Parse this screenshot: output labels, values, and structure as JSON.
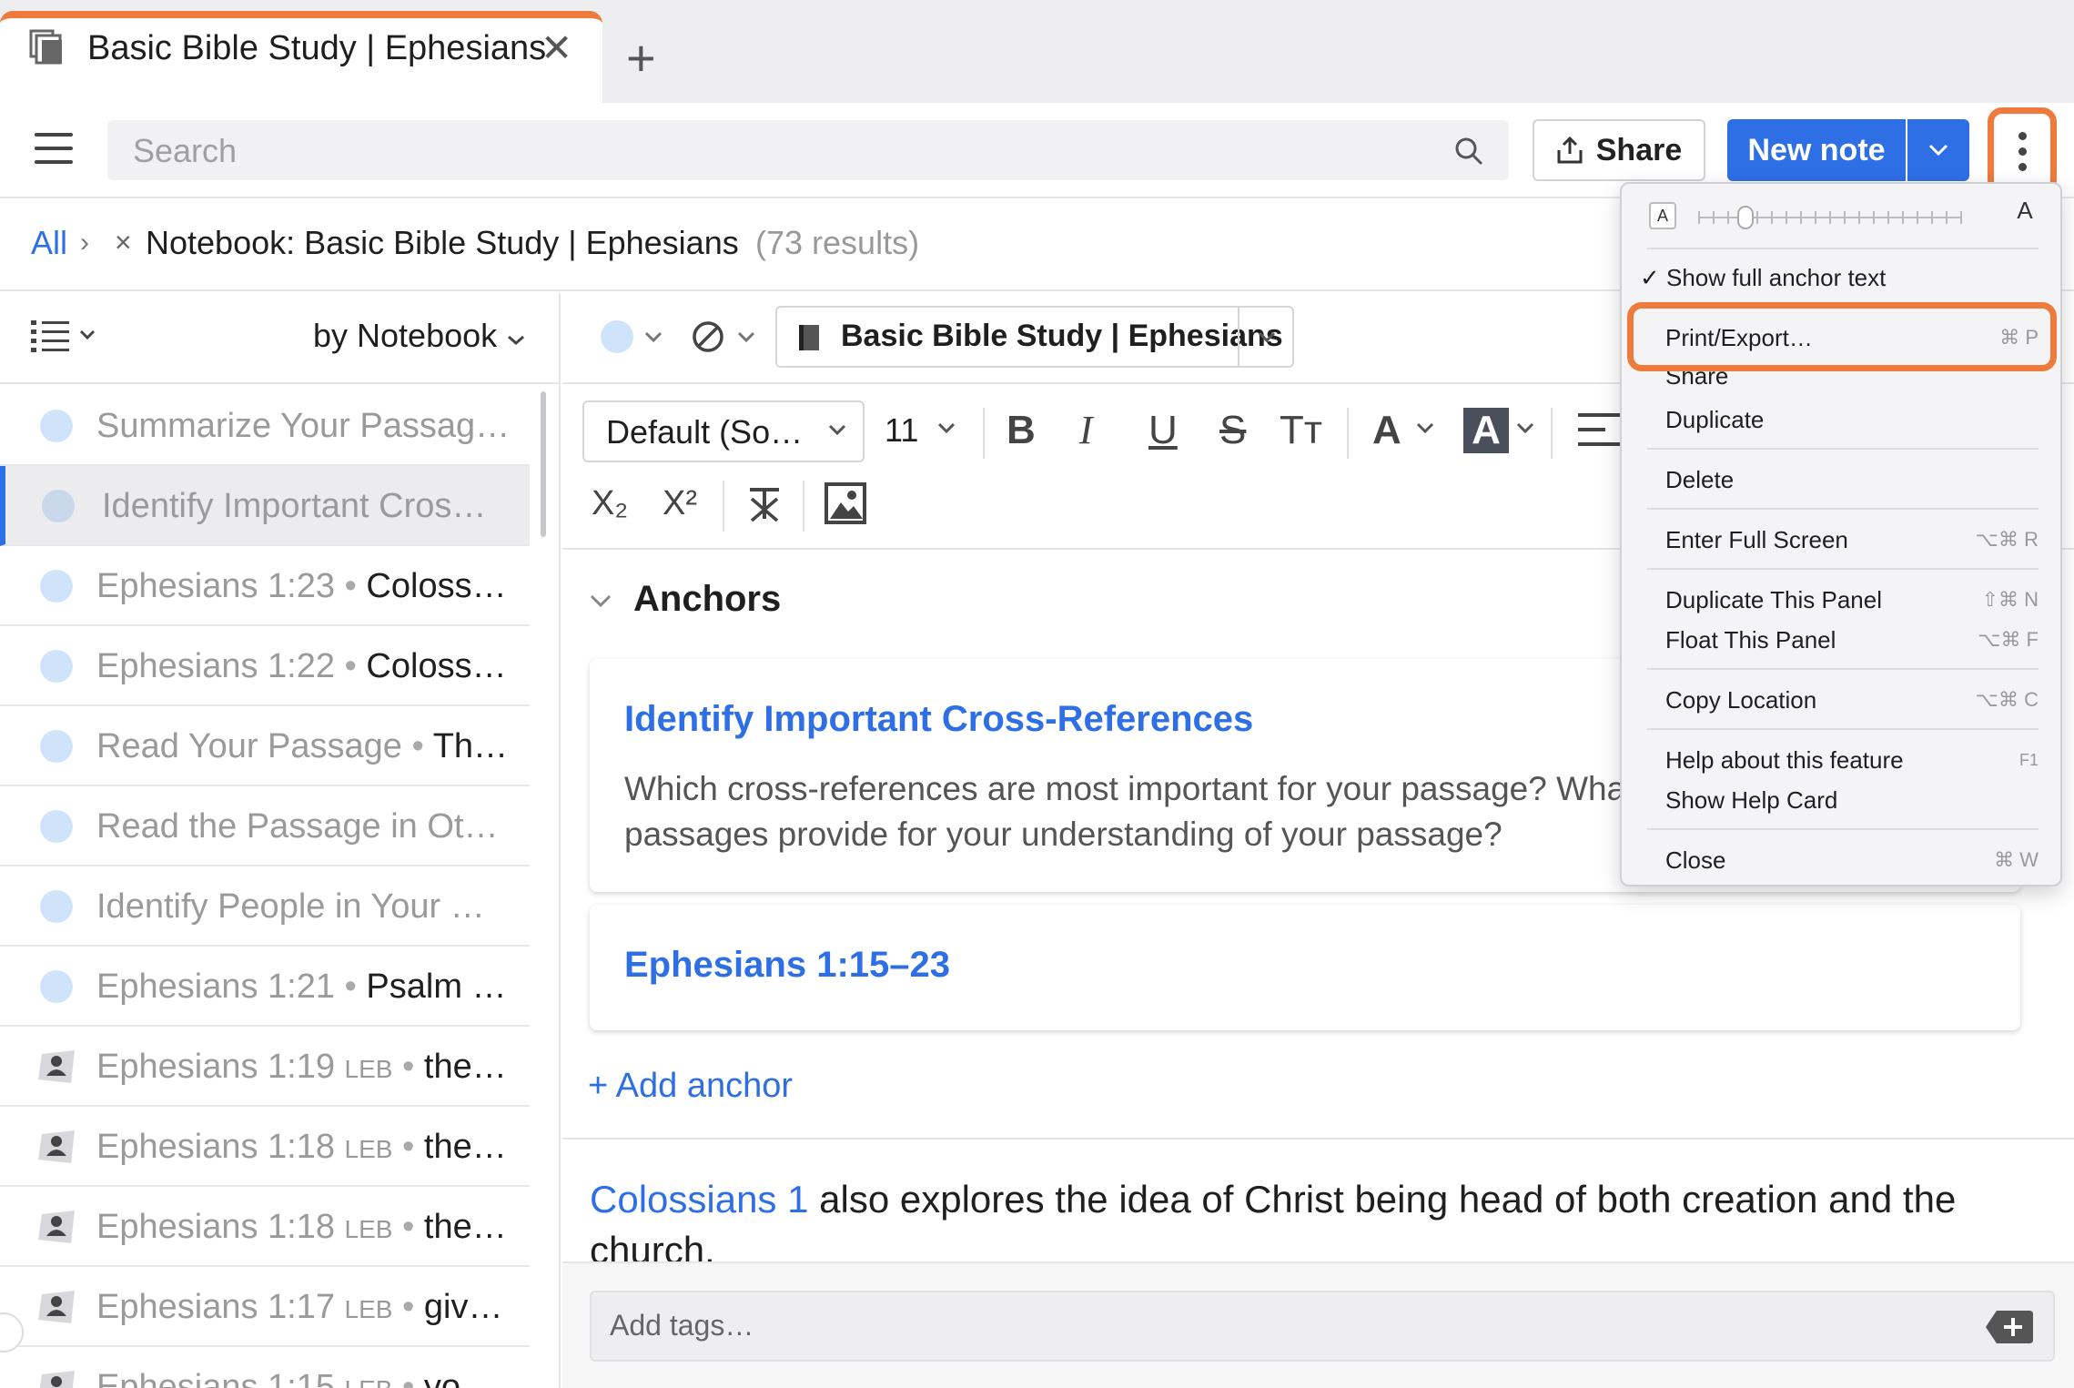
{
  "tab": {
    "title": "Basic Bible Study | Ephesians",
    "close": "✕",
    "add": "+"
  },
  "toolbar": {
    "search_placeholder": "Search",
    "share_label": "Share",
    "new_note_label": "New note"
  },
  "breadcrumb": {
    "all": "All",
    "chevron": "›",
    "remove": "×",
    "notebook": "Notebook: Basic Bible Study | Ephesians",
    "count": "(73 results)"
  },
  "list": {
    "sort_label": "by Notebook",
    "items": [
      {
        "title": "Summarize Your Passag…",
        "verse": "",
        "body": "",
        "icon": "dot"
      },
      {
        "title": "Identify Important Cros…",
        "verse": "",
        "body": "",
        "icon": "dot",
        "selected": true
      },
      {
        "title": "Ephesians 1:23",
        "verse": "",
        "body": "Coloss…",
        "icon": "dot"
      },
      {
        "title": "Ephesians 1:22",
        "verse": "",
        "body": "Coloss…",
        "icon": "dot"
      },
      {
        "title": "Read Your Passage",
        "verse": "",
        "body": "Th…",
        "icon": "dot"
      },
      {
        "title": "Read the Passage in Oth…",
        "verse": "",
        "body": "",
        "icon": "dot"
      },
      {
        "title": "Identify People in Your …",
        "verse": "",
        "body": "",
        "icon": "dot"
      },
      {
        "title": "Ephesians 1:21",
        "verse": "",
        "body": "Psalm …",
        "icon": "dot"
      },
      {
        "title": "Ephesians 1:19",
        "verse": "LEB",
        "body": "the…",
        "icon": "person"
      },
      {
        "title": "Ephesians 1:18",
        "verse": "LEB",
        "body": "the…",
        "icon": "person"
      },
      {
        "title": "Ephesians 1:18",
        "verse": "LEB",
        "body": "the…",
        "icon": "person"
      },
      {
        "title": "Ephesians 1:17",
        "verse": "LEB",
        "body": "giv…",
        "icon": "person"
      },
      {
        "title": "Ephesians 1:15",
        "verse": "LEB",
        "body": "yo…",
        "icon": "person"
      }
    ]
  },
  "editor": {
    "notebook_select": "Basic Bible Study | Ephesians",
    "font_family": "Default (So…",
    "font_size": "11",
    "format_buttons": {
      "bold": "B",
      "italic": "I",
      "underline": "U",
      "strike": "S",
      "caps": "Tт",
      "font_color": "A",
      "highlight": "A",
      "subscript": "X₂",
      "superscript": "X²"
    },
    "anchors_title": "Anchors",
    "card1_title": "Identify Important Cross-References",
    "card1_body": "Which cross-references are most important for your passage? What insights do the related passages provide for your understanding of your passage?",
    "card2_title": "Ephesians 1:15–23",
    "add_anchor": "+ Add anchor",
    "note_link": "Colossians 1",
    "note_text": " also explores the idea of Christ being head of both creation and the church.",
    "tags_placeholder": "Add tags…"
  },
  "dropdown": {
    "slider_small": "A",
    "slider_large": "A",
    "font_size_level": 0.18,
    "items": {
      "show_full_anchor": "✓ Show full anchor text",
      "print_export": "Print/Export…",
      "print_export_sc": "⌘ P",
      "share": "Share",
      "duplicate": "Duplicate",
      "delete": "Delete",
      "full_screen": "Enter Full Screen",
      "full_screen_sc": "⌥⌘ R",
      "dup_panel": "Duplicate This Panel",
      "dup_panel_sc": "⇧⌘ N",
      "float_panel": "Float This Panel",
      "float_panel_sc": "⌥⌘ F",
      "copy_location": "Copy Location",
      "copy_location_sc": "⌥⌘ C",
      "help_feature": "Help about this feature",
      "help_feature_sc": "F1",
      "help_card": "Show Help Card",
      "close": "Close",
      "close_sc": "⌘ W"
    }
  },
  "colors": {
    "accent": "#2f6fe6",
    "highlight": "#ee7a3c",
    "note_dot": "#cfe3fb"
  }
}
